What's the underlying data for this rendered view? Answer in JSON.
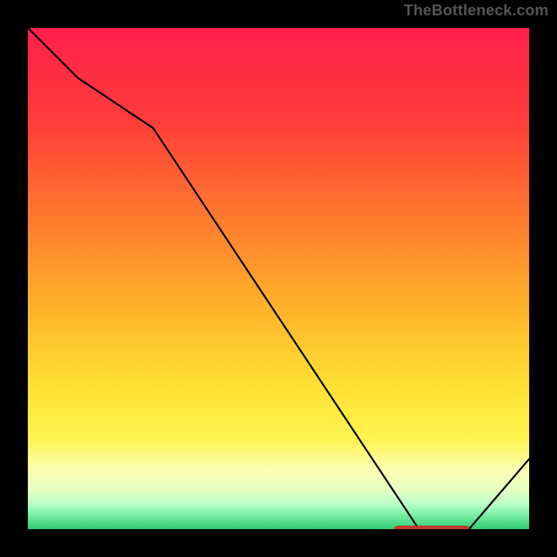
{
  "watermark": "TheBottleneck.com",
  "chart_data": {
    "type": "line",
    "title": "",
    "xlabel": "",
    "ylabel": "",
    "x_range": [
      0,
      100
    ],
    "y_range": [
      0,
      100
    ],
    "series": [
      {
        "name": "curve",
        "x": [
          0,
          10,
          25,
          78,
          88,
          100
        ],
        "y": [
          100,
          90,
          80,
          0,
          0,
          14
        ]
      }
    ],
    "optimal_band": {
      "x_start": 73,
      "x_end": 88,
      "y": 0
    },
    "gradient_stops": [
      {
        "offset": 0,
        "color": "#ff1f4b"
      },
      {
        "offset": 18,
        "color": "#ff3b3b"
      },
      {
        "offset": 38,
        "color": "#ff7a2e"
      },
      {
        "offset": 55,
        "color": "#ffb02a"
      },
      {
        "offset": 72,
        "color": "#ffe233"
      },
      {
        "offset": 82,
        "color": "#fff450"
      },
      {
        "offset": 88,
        "color": "#fdffb0"
      },
      {
        "offset": 92,
        "color": "#e8ffc0"
      },
      {
        "offset": 95,
        "color": "#b8ffc8"
      },
      {
        "offset": 97,
        "color": "#7ef0a8"
      },
      {
        "offset": 100,
        "color": "#2ecc71"
      }
    ],
    "colors": {
      "curve": "#000000",
      "marker": "#c0392b",
      "frame": "#000000"
    }
  }
}
